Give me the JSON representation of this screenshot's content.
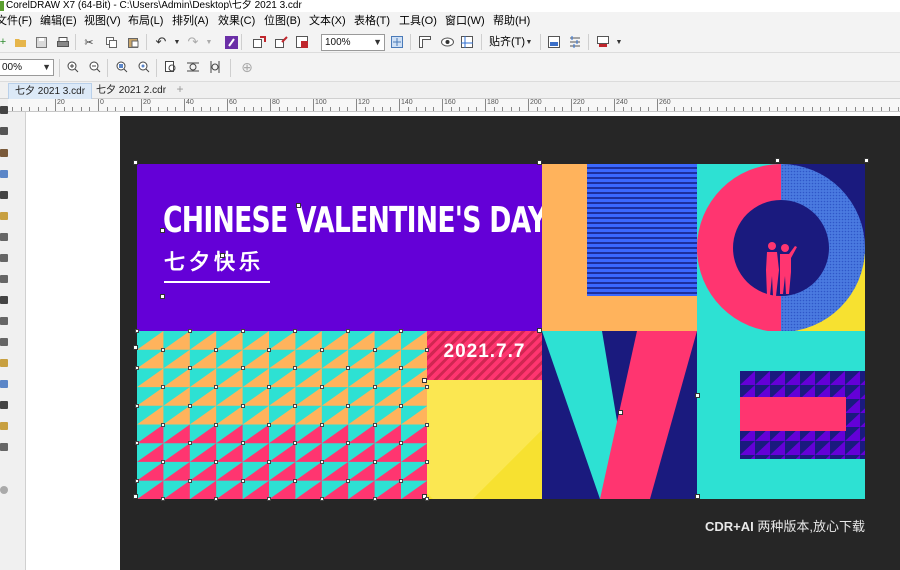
{
  "window": {
    "title": "CorelDRAW X7 (64-Bit) - C:\\Users\\Admin\\Desktop\\七夕 2021 3.cdr"
  },
  "menu": [
    {
      "label": "文件(F)"
    },
    {
      "label": "编辑(E)"
    },
    {
      "label": "视图(V)"
    },
    {
      "label": "布局(L)"
    },
    {
      "label": "排列(A)"
    },
    {
      "label": "效果(C)"
    },
    {
      "label": "位图(B)"
    },
    {
      "label": "文本(X)"
    },
    {
      "label": "表格(T)"
    },
    {
      "label": "工具(O)"
    },
    {
      "label": "窗口(W)"
    },
    {
      "label": "帮助(H)"
    }
  ],
  "toolbar": {
    "zoom_value": "100%",
    "snap_label": "贴齐(T)",
    "icons": [
      "new-icon",
      "open-icon",
      "save-icon",
      "print-icon",
      "cut-icon",
      "copy-icon",
      "paste-icon",
      "undo-icon",
      "redo-icon",
      "corel-connect-icon",
      "import-icon",
      "export-icon",
      "publish-pdf-icon",
      "full-screen-icon",
      "rulers-icon",
      "view-mode-icon",
      "guidelines-icon",
      "options-icon",
      "settings-icon",
      "color-icon"
    ]
  },
  "property_bar": {
    "zoom_value": "00%",
    "icons": [
      "zoom-in-icon",
      "zoom-out-icon",
      "zoom-selected-icon",
      "zoom-all-icon",
      "zoom-page-icon",
      "zoom-width-icon",
      "zoom-height-icon",
      "add-icon"
    ]
  },
  "tabs": [
    {
      "label": "七夕 2021 3.cdr",
      "active": true
    },
    {
      "label": "七夕 2021 2.cdr",
      "active": false
    }
  ],
  "ruler": {
    "labels": [
      "20",
      "0",
      "20",
      "40",
      "60",
      "80",
      "100",
      "120",
      "140",
      "160",
      "180",
      "200",
      "220",
      "240",
      "260"
    ]
  },
  "design": {
    "title": "CHINESE VALENTINE'S DAY",
    "subtitle_cn": "七夕快乐",
    "date": "2021.7.7",
    "colors": {
      "purple": "#6400d7",
      "navy": "#1a1a7e",
      "teal": "#2de1d3",
      "pink": "#ff3570",
      "yellow": "#f7e130",
      "orange": "#ffb35c",
      "blue": "#3a68ff"
    }
  },
  "watermark": {
    "brand": "CDR+AI",
    "text": " 两种版本,放心下载"
  }
}
